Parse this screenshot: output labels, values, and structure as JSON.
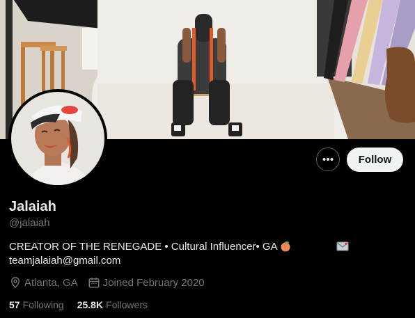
{
  "profile": {
    "display_name": "Jalaiah",
    "handle": "@jalaiah",
    "bio_line1": "CREATOR OF THE RENEGADE •   Cultural Influencer• GA",
    "bio_line2": "teamjalaiah@gmail.com",
    "location": "Atlanta, GA",
    "joined": "Joined February 2020"
  },
  "stats": {
    "following_count": "57",
    "following_label": "Following",
    "followers_count": "25.8K",
    "followers_label": "Followers"
  },
  "actions": {
    "more_label": "•••",
    "follow_label": "Follow"
  },
  "icons": {
    "more": "more-icon",
    "location": "location-icon",
    "calendar": "calendar-icon",
    "peach": "peach-emoji-icon",
    "envelope": "envelope-emoji-icon"
  },
  "colors": {
    "background": "#000000",
    "primary_text": "#e7e9ea",
    "secondary_text": "#71767b",
    "follow_button_bg": "#eff3f4",
    "follow_button_text": "#0f1419",
    "border": "#536471"
  }
}
